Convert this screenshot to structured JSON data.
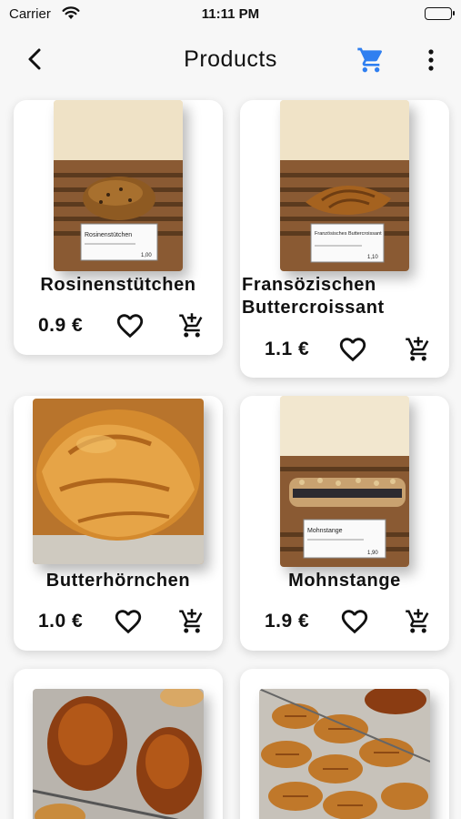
{
  "status": {
    "carrier": "Carrier",
    "time": "11:11 PM"
  },
  "nav": {
    "title": "Products"
  },
  "colors": {
    "accent": "#2f7ff0",
    "text": "#111111"
  },
  "icons": {
    "back": "chevron-left-icon",
    "cart": "shopping-cart-icon",
    "more": "more-vert-icon",
    "favorite": "heart-outline-icon",
    "add_to_cart": "add-shopping-cart-icon"
  },
  "products": [
    {
      "name": "Rosinenstütchen",
      "price": "0.9 €"
    },
    {
      "name": "Fransözischen Buttercroissant",
      "price": "1.1 €"
    },
    {
      "name": "Butterhörnchen",
      "price": "1.0 €"
    },
    {
      "name": "Mohnstange",
      "price": "1.9 €"
    },
    {
      "name": "",
      "price": ""
    },
    {
      "name": "",
      "price": ""
    }
  ],
  "photo_labels": {
    "p0": {
      "label": "Rosinenstütchen",
      "price": "1,00"
    },
    "p1": {
      "label": "Französisches Buttercroissant",
      "price": "1,10"
    },
    "p3": {
      "label": "Mohnstange",
      "price": "1,90"
    }
  }
}
